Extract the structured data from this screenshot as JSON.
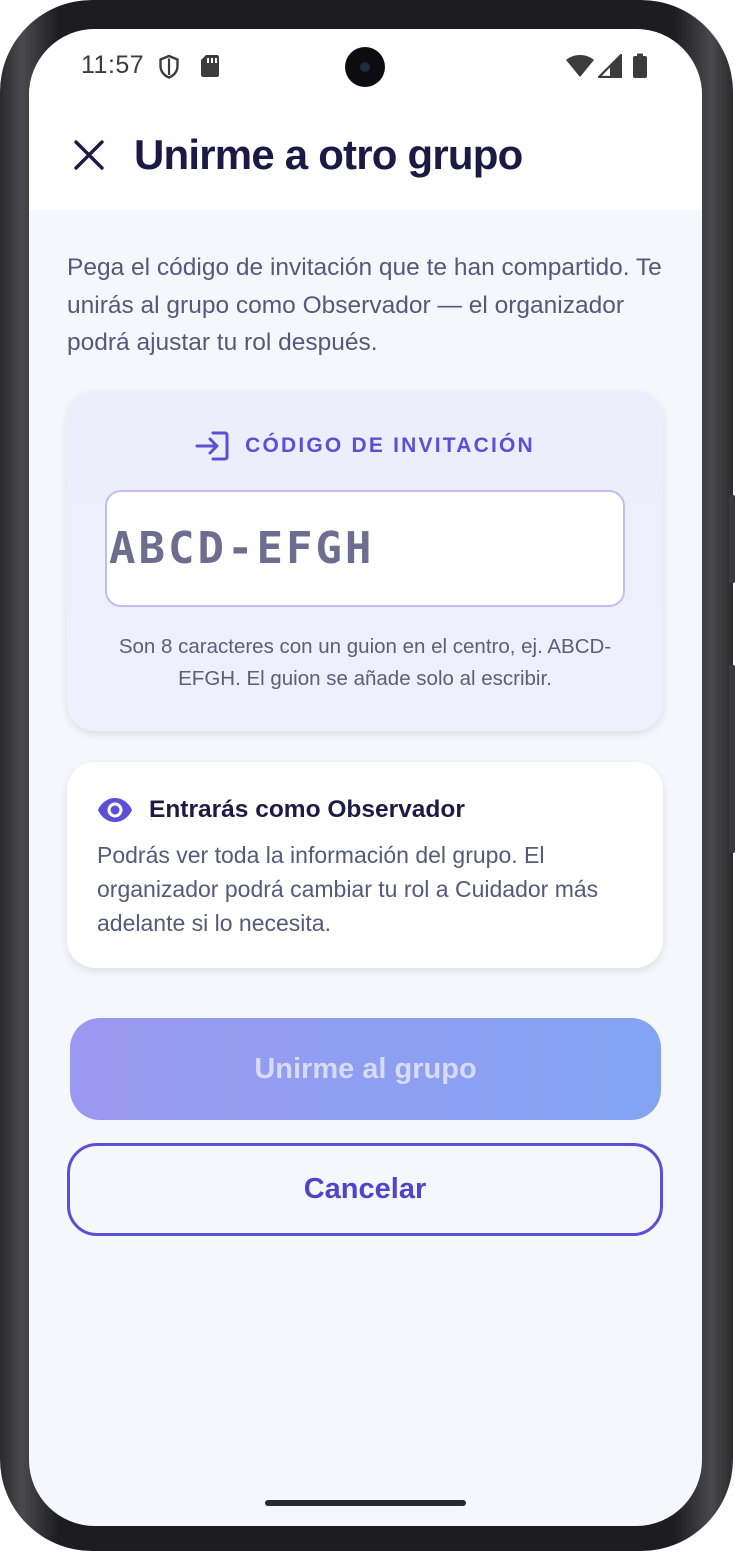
{
  "status_bar": {
    "time": "11:57",
    "icons": [
      "shield-icon",
      "sd-card-icon",
      "wifi-icon",
      "cell-signal-icon",
      "battery-icon"
    ]
  },
  "app_bar": {
    "title": "Unirme a otro grupo",
    "close_icon": "close-icon"
  },
  "intro_text": "Pega el código de invitación que te han compartido. Te unirás al grupo como Observador — el organizador podrá ajustar tu rol después.",
  "code_card": {
    "header_icon": "login-arrow-icon",
    "header_label": "CÓDIGO DE INVITACIÓN",
    "input_placeholder": "ABCD-EFGH",
    "input_value": "",
    "hint": "Son 8 caracteres con un guion en el centro, ej. ABCD-EFGH. El guion se añade solo al escribir."
  },
  "info_card": {
    "icon": "eye-icon",
    "title": "Entrarás como Observador",
    "body": "Podrás ver toda la información del grupo. El organizador podrá cambiar tu rol a Cuidador más adelante si lo necesita."
  },
  "actions": {
    "join_label": "Unirme al grupo",
    "join_enabled": false,
    "cancel_label": "Cancelar"
  },
  "colors": {
    "accent": "#5a4fd6",
    "title": "#1c1a44",
    "body_text": "#55597a",
    "card_tint": "#eceefc",
    "background": "#f6f7fd",
    "join_gradient_start": "#9b98f0",
    "join_gradient_end": "#83a4f3"
  }
}
